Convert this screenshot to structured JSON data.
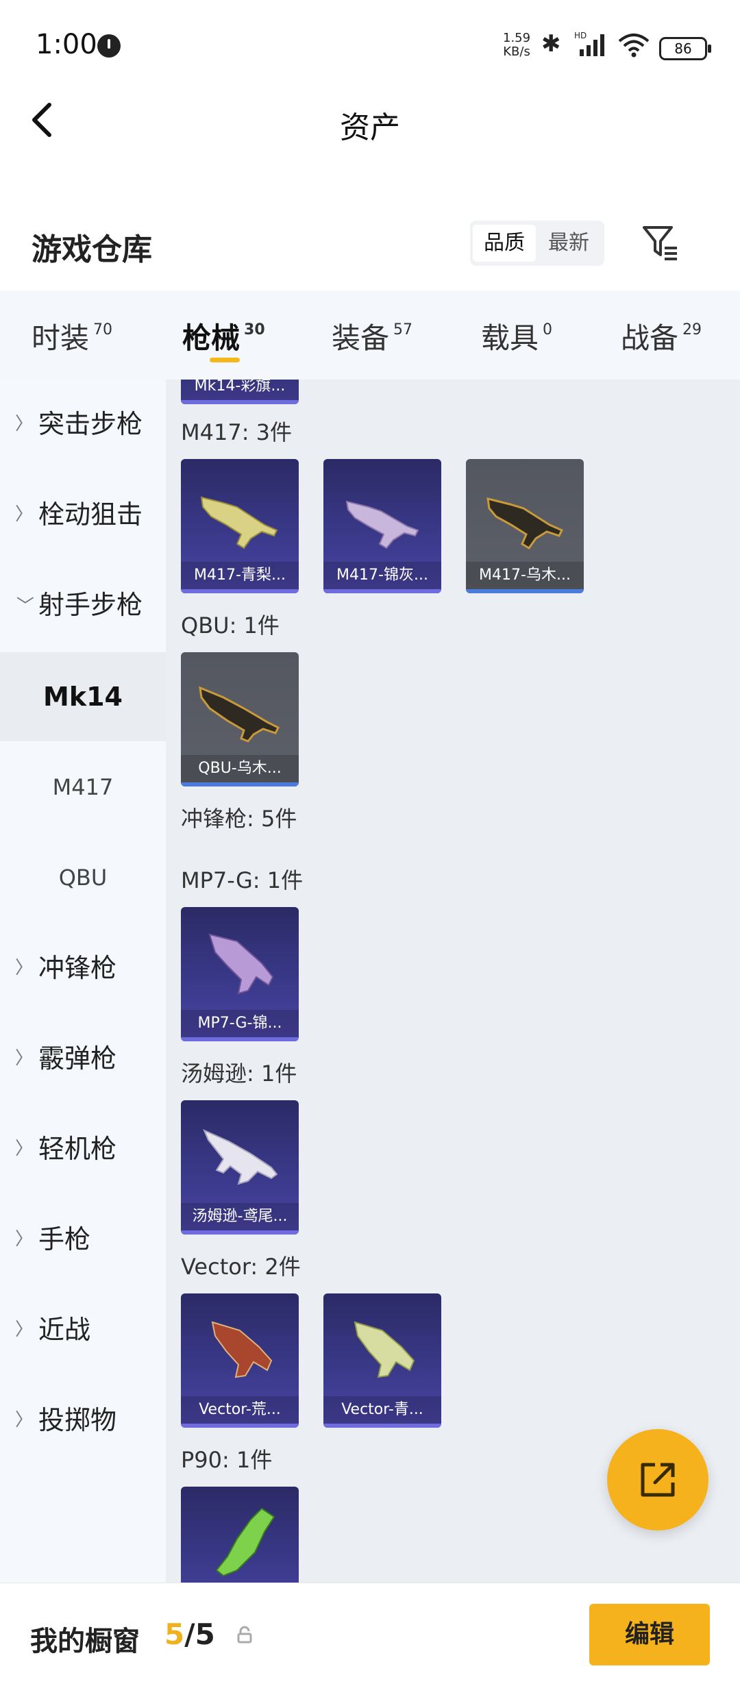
{
  "status": {
    "time": "1:00",
    "speed_value": "1.59",
    "speed_unit": "KB/s",
    "battery": "86",
    "wifi_label": "6"
  },
  "header": {
    "title": "资产"
  },
  "section": {
    "title": "游戏仓库",
    "sort_quality": "品质",
    "sort_latest": "最新"
  },
  "tabs": [
    {
      "label": "时装",
      "count": "70"
    },
    {
      "label": "枪械",
      "count": "30"
    },
    {
      "label": "装备",
      "count": "57"
    },
    {
      "label": "载具",
      "count": "0"
    },
    {
      "label": "战备",
      "count": "29"
    }
  ],
  "sidebar": {
    "items": [
      {
        "label": "突击步枪"
      },
      {
        "label": "栓动狙击"
      },
      {
        "label": "射手步枪"
      },
      {
        "label": "Mk14"
      },
      {
        "label": "M417"
      },
      {
        "label": "QBU"
      },
      {
        "label": "冲锋枪"
      },
      {
        "label": "霰弹枪"
      },
      {
        "label": "轻机枪"
      },
      {
        "label": "手枪"
      },
      {
        "label": "近战"
      },
      {
        "label": "投掷物"
      }
    ]
  },
  "content": {
    "top_partial_caption": "Mk14-彩旗...",
    "groups": {
      "m417": "M417: 3件",
      "qbu": "QBU: 1件",
      "smg": "冲锋枪: 5件",
      "mp7": "MP7-G: 1件",
      "tommy": "汤姆逊: 1件",
      "vector": "Vector: 2件",
      "p90": "P90: 1件"
    },
    "cards": {
      "m417_1": "M417-青梨...",
      "m417_2": "M417-锦灰...",
      "m417_3": "M417-乌木...",
      "qbu_1": "QBU-乌木...",
      "mp7_1": "MP7-G-锦...",
      "tommy_1": "汤姆逊-鸢尾...",
      "vector_1": "Vector-荒...",
      "vector_2": "Vector-青..."
    }
  },
  "bottom": {
    "label": "我的橱窗",
    "count_current": "5",
    "count_total": "/5",
    "edit": "编辑"
  },
  "colors": {
    "accent": "#f6b21c",
    "card_purple": "#3b3a8c",
    "card_grey": "#5a5d66",
    "content_bg": "#ebeef3"
  }
}
